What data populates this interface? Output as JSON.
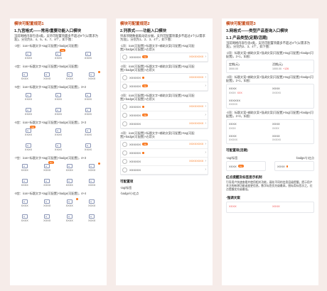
{
  "col1": {
    "title": "模块可配置规范1",
    "section_title": "1.九宫格式——常用/重要功能入口模块",
    "description": "当前网格内容包含3类，支持可配置项最多不超过9个(以需求为准)，分别为3、4、5、6、7、8个，如下图：",
    "blocks": [
      {
        "caption": "·3宫：icon+标题文字+tag(可配置)+badge(可配置)",
        "cols": 3,
        "rows": 1,
        "tag": "tag",
        "tag_tile": 1,
        "dot_tile": -1
      },
      {
        "caption": "·4宫：icon+标题文字+tag(可配置)+badge(可配置)",
        "cols": 4,
        "rows": 1,
        "tag": "",
        "tag_tile": -1,
        "dot_tile": 3
      },
      {
        "caption": "·5宫：icon+标题文字+tag(可配置)+badge(可配置)，3+2",
        "cols": 3,
        "rows": 2,
        "tag": "",
        "tag_tile": -1,
        "dot_tile": -1
      },
      {
        "caption": "·6宫：icon+标题文字+tag(可配置)+badge(可配置)，3+3",
        "cols": 3,
        "rows": 2,
        "tag": "tag",
        "tag_tile": 0,
        "dot_tile": -1
      },
      {
        "caption": "·7宫：icon+标题文字+tag(可配置)+badge(可配置)，4+3",
        "cols": 4,
        "rows": 2,
        "tag": "tag",
        "tag_tile": 1,
        "dot_tile": 3
      },
      {
        "caption": "·8宫：icon+标题文字+tag(可配置)+badge(可配置)，4+4",
        "cols": 4,
        "rows": 2,
        "tag": "",
        "tag_tile": -1,
        "dot_tile": 2
      }
    ],
    "tile_label": "XXXX"
  },
  "col2": {
    "title": "模块可配置规范2",
    "section_title": "2.列表式——功能入口模块",
    "description": "列表项随数据类动态分展，支持可配置项最多不超过4个(以需求为准)，分别为1、2、3、4个，如下图：",
    "blocks": [
      {
        "caption": "·1项：icon(可配置)+标题文字+辅助文案(可配置)+tag(可配置)+badge(可配置)+右箭头",
        "rows": [
          {
            "text": "XXXXXX",
            "tag": "tag",
            "dot": false,
            "right": "XXXXXXXX"
          }
        ]
      },
      {
        "caption": "·2项：icon(可配置)+标题文字+辅助文案(可配置)+tag(可配置)+badge(可配置)+右箭头",
        "rows": [
          {
            "text": "XXXXXX",
            "tag": "",
            "dot": true,
            "right": "XXXXXXXX"
          },
          {
            "text": "XXXXXX",
            "tag": "tag",
            "dot": false,
            "right": ""
          }
        ]
      },
      {
        "caption": "·3项：icon(可配置)+标题文字+辅助文案(可配置)+tag(可配置)+badge(可配置)+右箭头",
        "rows": [
          {
            "text": "XXXXXX",
            "tag": "",
            "dot": true,
            "right": "XXXXXXXX"
          },
          {
            "text": "XXXXXX",
            "tag": "tag",
            "dot": false,
            "right": ""
          },
          {
            "text": "XXXXXX",
            "tag": "",
            "dot": false,
            "right": "XXXXXXXX"
          }
        ]
      },
      {
        "caption": "·4项：icon(可配置)+标题文字+辅助文案(可配置)+tag(可配置)+badge(可配置)+右箭头",
        "rows": [
          {
            "text": "XXXXXX",
            "tag": "tag",
            "dot": false,
            "right": "XXXXXXXX"
          },
          {
            "text": "XXXXXX",
            "tag": "",
            "dot": true,
            "right": ""
          },
          {
            "text": "XXXXXX",
            "tag": "",
            "dot": false,
            "right": "XXXXXXXX"
          },
          {
            "text": "XXXXXX",
            "tag": "",
            "dot": false,
            "right": ""
          }
        ]
      }
    ],
    "config_title": "可配置项",
    "tag_title": "·tag/标签",
    "badge_title": "·badge/小红点"
  },
  "col3": {
    "title": "模块可配置规范3",
    "section_title": "3.网格式——类型产品查询入口模块",
    "sub_section": "1.1 产品类型(定期/活期)",
    "description": "当前网格内容包含2类，支持可配置项最多不超过4个(以需求为准)，分别为2、3、4个，如下图：",
    "item1_caption": "·2项：标题文案+辅助文案+强调文案(可配置)+tag(可配置)+badge(可配置)，2+1，如图：",
    "item1_cells": [
      {
        "title": "定期(元)",
        "value": "3000.00",
        "red": ""
      },
      {
        "title": "活期(元)",
        "value": "1000.00",
        "red": "+126"
      }
    ],
    "item2_caption": "·3项：标题文案+辅助文案+强调文案(可配置)+tag(可配置)+badge(可配置)，2+1，如图：",
    "item2_cells": [
      {
        "title": "XXXX",
        "value": "XXXX",
        "red": "XXX"
      },
      {
        "title": "XXXX",
        "value": "XXXXX",
        "red": ""
      },
      {
        "title": "XXXXXX",
        "value": "XXXXX",
        "red": ""
      }
    ],
    "item3_caption": "·4项：标题文案+辅助文案+强调文案(可配置)+tag(可配置)+badge(可配置)，2+3，如图：",
    "item3_cells": [
      {
        "title": "XXXX",
        "value": "XXXX",
        "red": ""
      },
      {
        "title": "XXXX",
        "value": "XXXX",
        "red": ""
      },
      {
        "title": "XXXX",
        "value": "XXXXX",
        "red": ""
      },
      {
        "title": "XXXX",
        "value": "XXXXX",
        "red": ""
      }
    ],
    "config_title": "可配置项(活期)",
    "tag_label": "·tag/标签",
    "badge_label": "·badge/小红点",
    "tag_sample": "XXXX",
    "badge_sample": "XXXX",
    "rules_title": "红点提醒及标签显示机制",
    "rules_text": "引导用户快速查看并使用相关功能，弱化不同的信息层级提醒，提示用户关注的新增功能或变更信息。数字标签优先级最高，图标类标签次之，红点提醒优先级最低。",
    "emphasis_title": "·强调文案",
    "emphasis_samples": [
      "XXXX",
      "XXXX"
    ]
  }
}
